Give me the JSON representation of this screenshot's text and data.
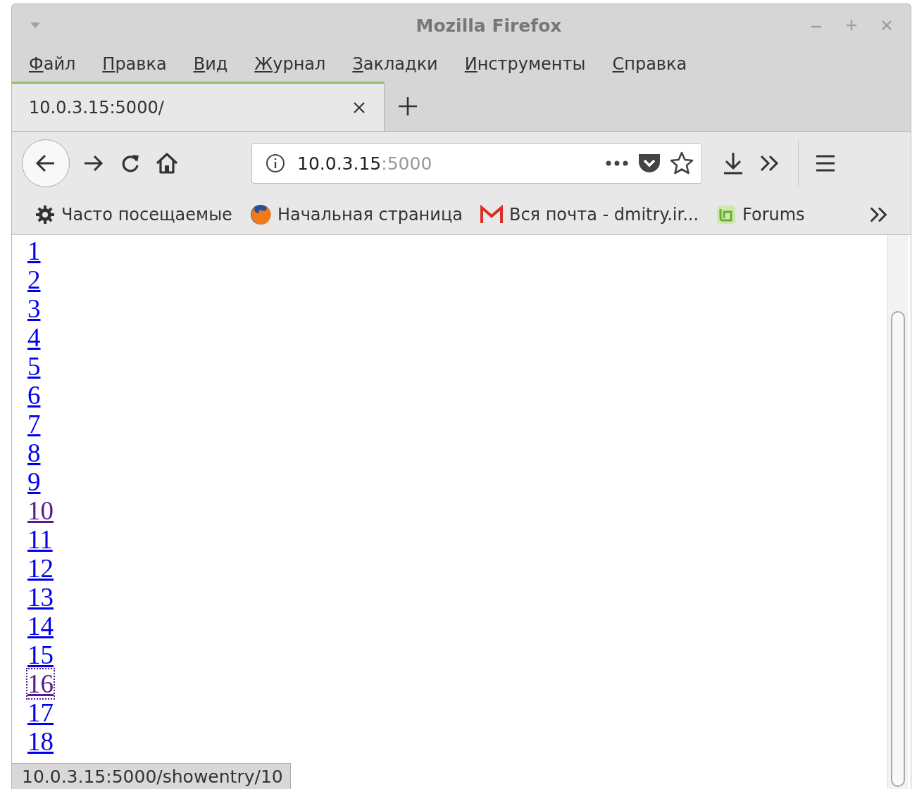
{
  "window": {
    "title": "Mozilla Firefox"
  },
  "menu": [
    "Файл",
    "Правка",
    "Вид",
    "Журнал",
    "Закладки",
    "Инструменты",
    "Справка"
  ],
  "tabs": [
    {
      "label": "10.0.3.15:5000/",
      "selected": true
    }
  ],
  "address_bar": {
    "host": "10.0.3.15",
    "port": ":5000"
  },
  "bookmarks": [
    {
      "kind": "gear",
      "label": "Часто посещаемые"
    },
    {
      "kind": "firefox",
      "label": "Начальная страница"
    },
    {
      "kind": "mail",
      "label": "Вся почта - dmitry.ir..."
    },
    {
      "kind": "mint",
      "label": "Forums"
    }
  ],
  "links": [
    {
      "text": "1",
      "visited": false,
      "focused": false
    },
    {
      "text": "2",
      "visited": false,
      "focused": false
    },
    {
      "text": "3",
      "visited": false,
      "focused": false
    },
    {
      "text": "4",
      "visited": false,
      "focused": false
    },
    {
      "text": "5",
      "visited": false,
      "focused": false
    },
    {
      "text": "6",
      "visited": false,
      "focused": false
    },
    {
      "text": "7",
      "visited": false,
      "focused": false
    },
    {
      "text": "8",
      "visited": false,
      "focused": false
    },
    {
      "text": "9",
      "visited": false,
      "focused": false
    },
    {
      "text": "10",
      "visited": true,
      "focused": false
    },
    {
      "text": "11",
      "visited": false,
      "focused": false
    },
    {
      "text": "12",
      "visited": false,
      "focused": false
    },
    {
      "text": "13",
      "visited": false,
      "focused": false
    },
    {
      "text": "14",
      "visited": false,
      "focused": false
    },
    {
      "text": "15",
      "visited": false,
      "focused": false
    },
    {
      "text": "16",
      "visited": true,
      "focused": true
    },
    {
      "text": "17",
      "visited": false,
      "focused": false
    },
    {
      "text": "18",
      "visited": false,
      "focused": false
    }
  ],
  "status_bar": "10.0.3.15:5000/showentry/10"
}
